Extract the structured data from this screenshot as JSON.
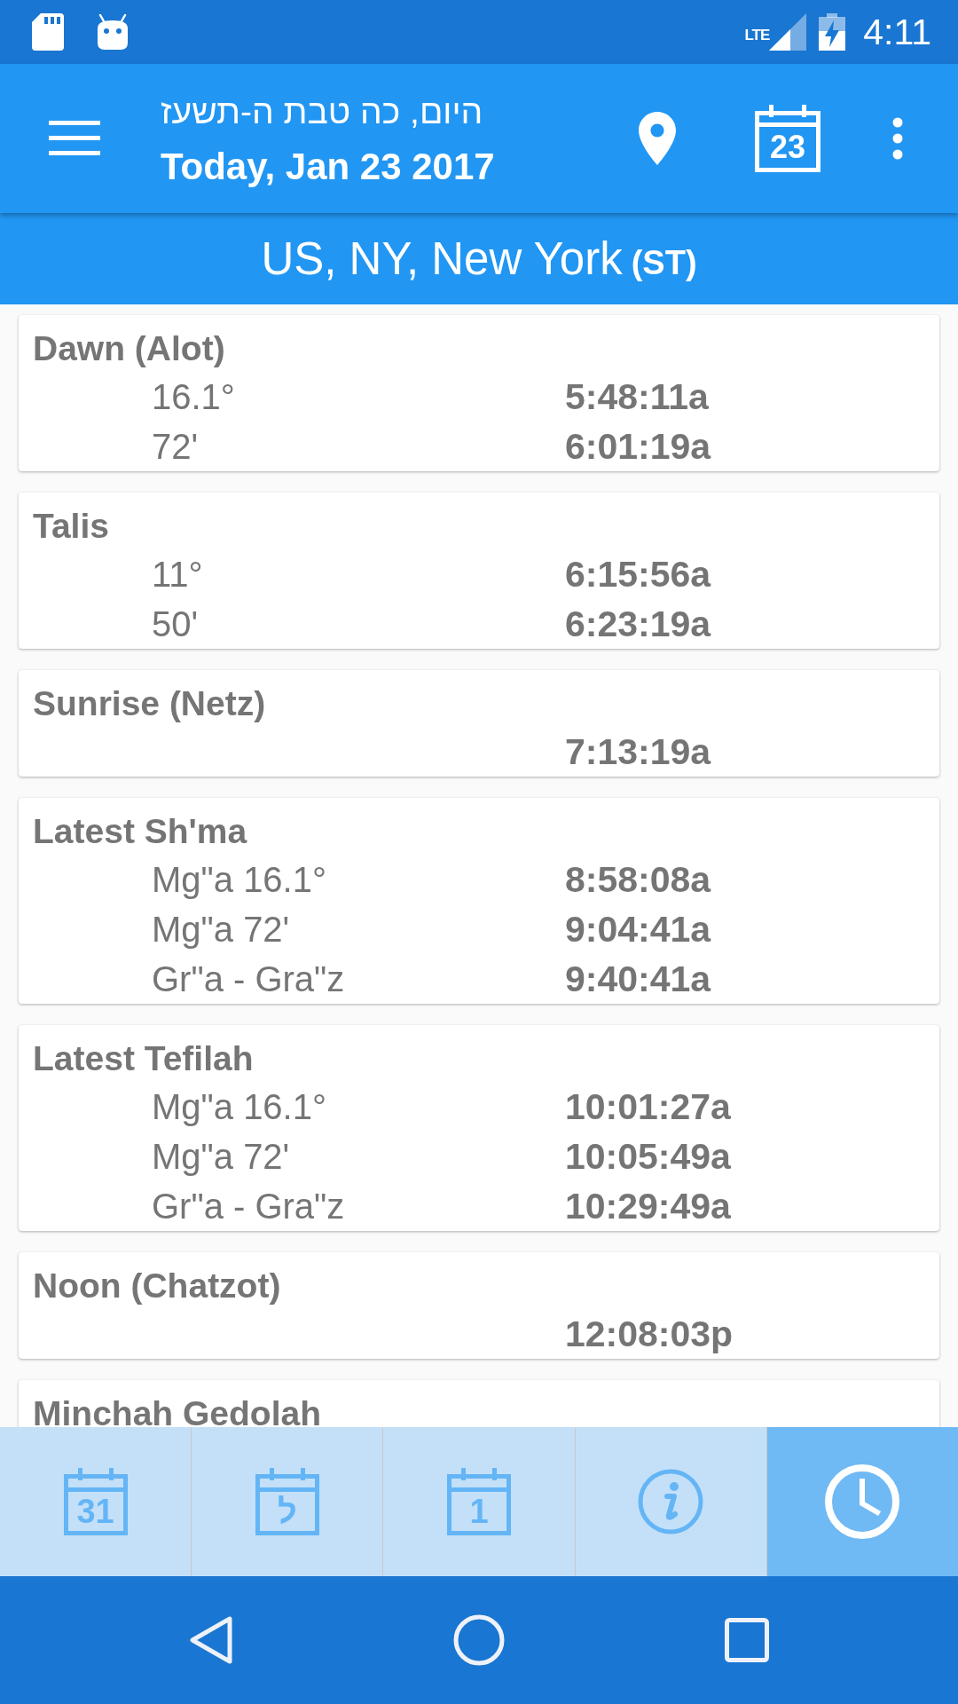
{
  "status_bar": {
    "network": "LTE",
    "time": "4:11"
  },
  "app_bar": {
    "hebrew_date": "היום, כה טבת ה-תשעז",
    "date": "Today, Jan 23 2017",
    "calendar_day": "23"
  },
  "location": {
    "place": "US, NY, New York",
    "zone": "(ST)"
  },
  "zmanim": [
    {
      "title": "Dawn (Alot)",
      "rows": [
        {
          "label": "16.1°",
          "time": "5:48:11a"
        },
        {
          "label": "72'",
          "time": "6:01:19a"
        }
      ]
    },
    {
      "title": "Talis",
      "rows": [
        {
          "label": "11°",
          "time": "6:15:56a"
        },
        {
          "label": "50'",
          "time": "6:23:19a"
        }
      ]
    },
    {
      "title": "Sunrise (Netz)",
      "rows": [
        {
          "time": "7:13:19a"
        }
      ]
    },
    {
      "title": "Latest Sh'ma",
      "rows": [
        {
          "label": "Mg\"a 16.1°",
          "time": "8:58:08a"
        },
        {
          "label": "Mg\"a 72'",
          "time": "9:04:41a"
        },
        {
          "label": "Gr\"a - Gra\"z",
          "time": "9:40:41a"
        }
      ]
    },
    {
      "title": "Latest Tefilah",
      "rows": [
        {
          "label": "Mg\"a 16.1°",
          "time": "10:01:27a"
        },
        {
          "label": "Mg\"a 72'",
          "time": "10:05:49a"
        },
        {
          "label": "Gr\"a - Gra\"z",
          "time": "10:29:49a"
        }
      ]
    },
    {
      "title": "Noon (Chatzot)",
      "rows": [
        {
          "time": "12:08:03p"
        }
      ]
    },
    {
      "title": "Minchah Gedolah"
    }
  ],
  "bottom_tabs": [
    {
      "kind": "calendar",
      "glyph": "31",
      "selected": false
    },
    {
      "kind": "calendar",
      "glyph": "ל",
      "selected": false
    },
    {
      "kind": "calendar",
      "glyph": "1",
      "selected": false
    },
    {
      "kind": "info",
      "selected": false
    },
    {
      "kind": "clock",
      "selected": true
    }
  ]
}
